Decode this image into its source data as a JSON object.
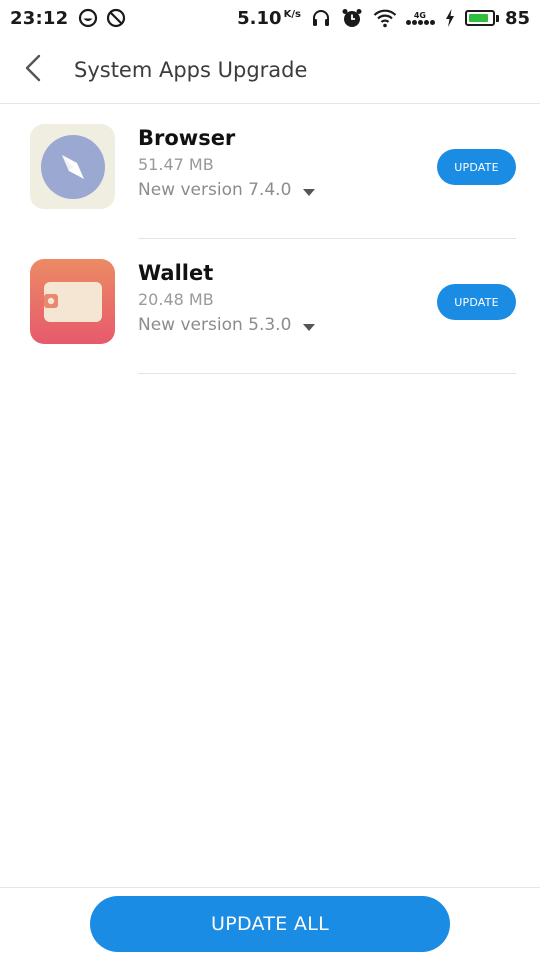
{
  "status_bar": {
    "time": "23:12",
    "net_speed": "5.10",
    "net_speed_unit": "K/s",
    "network_type": "4G",
    "battery_percent": "85",
    "battery_level": 0.85,
    "battery_color": "#2fbf3c",
    "icons": [
      "do-not-disturb-icon",
      "blocked-icon",
      "headphones-icon",
      "alarm-icon",
      "wifi-icon",
      "signal-icon",
      "charging-icon",
      "battery-icon"
    ]
  },
  "header": {
    "title": "System Apps Upgrade",
    "back_icon": "back-arrow-icon"
  },
  "apps": [
    {
      "name": "Browser",
      "size": "51.47 MB",
      "version": "New version 7.4.0",
      "button_label": "UPDATE",
      "icon": "compass-icon"
    },
    {
      "name": "Wallet",
      "size": "20.48 MB",
      "version": "New version 5.3.0",
      "button_label": "UPDATE",
      "icon": "wallet-icon"
    }
  ],
  "footer": {
    "update_all_label": "UPDATE ALL"
  },
  "colors": {
    "accent": "#1a8ce4",
    "browser_icon_bg": "#efeee1",
    "browser_icon_circle": "#9aa8d2",
    "wallet_gradient_top": "#eb8b64",
    "wallet_gradient_bottom": "#e75a6c"
  }
}
